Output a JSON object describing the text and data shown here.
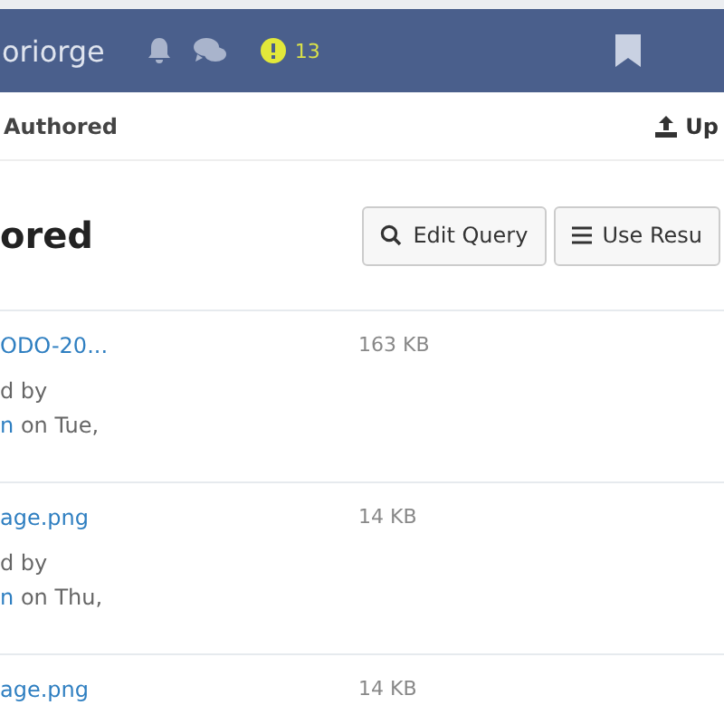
{
  "navbar": {
    "username": "oriorge",
    "alert_count": "13"
  },
  "subnav": {
    "tab": "Authored",
    "action": "Up"
  },
  "heading": "ored",
  "buttons": [
    {
      "label": "Edit Query",
      "kind": "search"
    },
    {
      "label": "Use Resu",
      "kind": "menu"
    }
  ],
  "files": [
    {
      "name": "ODO-20...",
      "size": "163 KB",
      "line_1": "d by",
      "author": "n",
      "date": "on Tue,"
    },
    {
      "name": "age.png",
      "size": "14 KB",
      "line_1": "d by",
      "author": "n",
      "date": "on Thu,"
    },
    {
      "name": "age.png",
      "size": "14 KB"
    }
  ]
}
